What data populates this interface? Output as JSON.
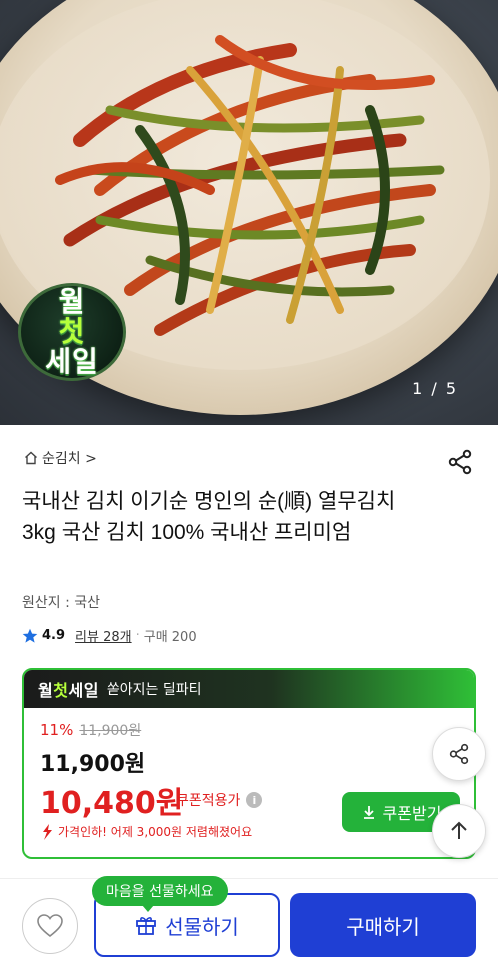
{
  "gallery": {
    "badge_line1_a": "월",
    "badge_line1_b": "첫",
    "badge_line2": "세일",
    "page_indicator": "1 / 5"
  },
  "breadcrumb": {
    "label": "순김치 >"
  },
  "product": {
    "title": "국내산 김치 이기순 명인의 순(順) 열무김치 3kg 국산 김치 100% 국내산 프리미엄",
    "origin": "원산지 : 국산",
    "rating": "4.9",
    "review_link": "리뷰 28개",
    "separator": "·",
    "purchase_count": "구매 200"
  },
  "deal": {
    "logo_a": "월",
    "logo_b": "첫",
    "logo_c": "세일",
    "subtitle": "쏟아지는 딜파티",
    "discount_pct": "11%",
    "original_price": "11,900원",
    "price": "11,900원",
    "coupon_price": "10,480원",
    "coupon_label": "쿠폰적용가",
    "info_mark": "i",
    "price_drop_note": "가격인하! 어제 3,000원 저렴해졌어요",
    "coupon_button": "쿠폰받기"
  },
  "bottom_bar": {
    "gift_tooltip": "마음을 선물하세요",
    "gift_button": "선물하기",
    "buy_button": "구매하기"
  },
  "colors": {
    "accent_green": "#24b23a",
    "sale_red": "#e02020",
    "primary_blue": "#1f3fd4"
  }
}
